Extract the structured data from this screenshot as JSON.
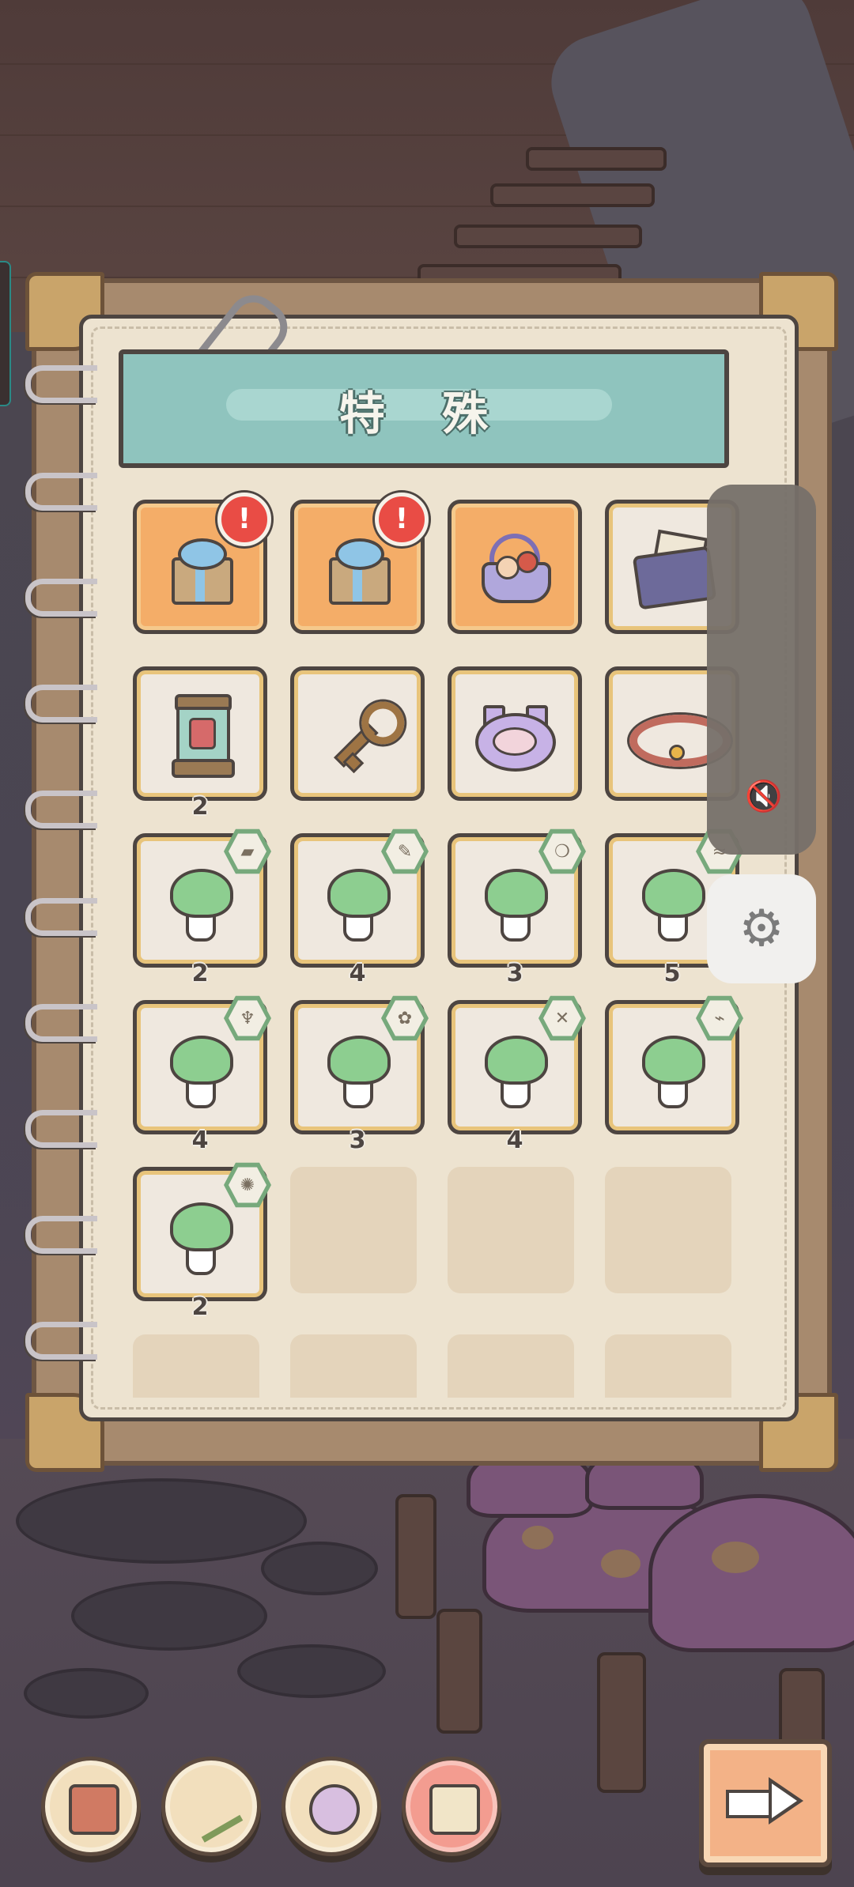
{
  "inventory": {
    "category_title": "特 殊",
    "rows": [
      [
        {
          "item": "gift-box",
          "style": "orange",
          "alert": "!",
          "count": ""
        },
        {
          "item": "gift-box",
          "style": "orange",
          "alert": "!",
          "count": ""
        },
        {
          "item": "flower-basket",
          "style": "orange",
          "alert": "",
          "count": ""
        },
        {
          "item": "bag-with-papers",
          "style": "filled",
          "alert": "",
          "count": ""
        }
      ],
      [
        {
          "item": "jar-lantern",
          "style": "filled",
          "alert": "",
          "count": "2"
        },
        {
          "item": "key",
          "style": "filled",
          "alert": "",
          "count": ""
        },
        {
          "item": "pet-bowl",
          "style": "filled",
          "alert": "",
          "count": ""
        },
        {
          "item": "collar",
          "style": "filled",
          "alert": "",
          "count": ""
        }
      ],
      [
        {
          "item": "mushroom",
          "badge": "pill",
          "count": "2"
        },
        {
          "item": "mushroom",
          "badge": "feather",
          "count": "4"
        },
        {
          "item": "mushroom",
          "badge": "leaf",
          "count": "3"
        },
        {
          "item": "mushroom",
          "badge": "wind",
          "count": "5"
        }
      ],
      [
        {
          "item": "mushroom",
          "badge": "cup",
          "count": "4"
        },
        {
          "item": "mushroom",
          "badge": "rose",
          "count": "3"
        },
        {
          "item": "mushroom",
          "badge": "cross",
          "count": "4"
        },
        {
          "item": "mushroom",
          "badge": "bird",
          "count": ""
        }
      ],
      [
        {
          "item": "mushroom",
          "badge": "sun",
          "count": "2"
        },
        {
          "item": "empty"
        },
        {
          "item": "empty"
        },
        {
          "item": "empty"
        }
      ],
      [
        {
          "item": "empty"
        },
        {
          "item": "empty"
        },
        {
          "item": "empty"
        },
        {
          "item": "empty"
        }
      ]
    ]
  },
  "overlay": {
    "volume_panel_icon": "mute-icon",
    "settings_icon": "gear-icon"
  },
  "bottom_bar": {
    "buttons": [
      "briefcase-icon",
      "branch-icon",
      "gear-cog-icon",
      "treasure-chest-icon"
    ],
    "active_index": 3,
    "next_icon": "arrow-right-icon"
  },
  "colors": {
    "slot_orange": "#f4ad68",
    "mushroom_cap": "#8dce90",
    "alert_badge": "#e94c45",
    "banner": "#8fc4be"
  }
}
